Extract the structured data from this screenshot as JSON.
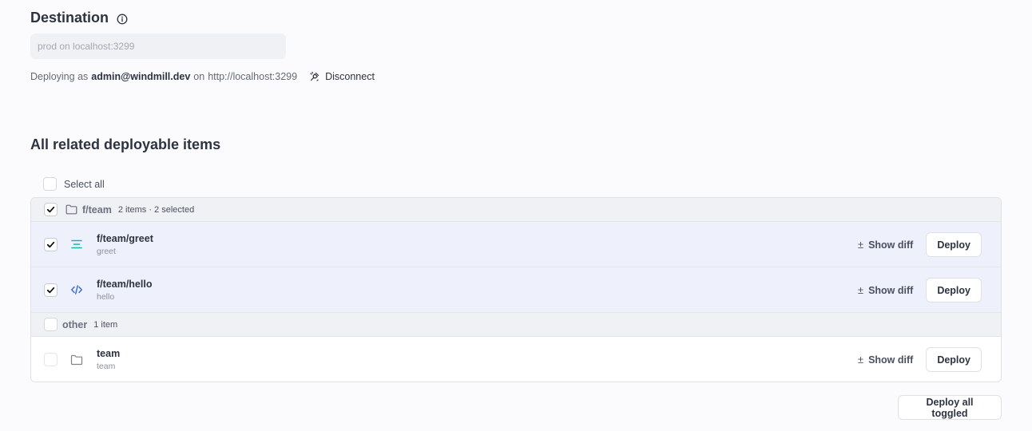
{
  "destination": {
    "title": "Destination",
    "placeholder": "prod on localhost:3299",
    "deploying_prefix": "Deploying as",
    "user": "admin@windmill.dev",
    "on_label": "on",
    "url": "http://localhost:3299",
    "disconnect_label": "Disconnect"
  },
  "items_section": {
    "title": "All related deployable items",
    "select_all_label": "Select all"
  },
  "groups": [
    {
      "name": "f/team",
      "meta": "2 items · 2 selected",
      "checked": true,
      "items": [
        {
          "path": "f/team/greet",
          "summary": "greet",
          "icon": "flow-icon",
          "checked": true
        },
        {
          "path": "f/team/hello",
          "summary": "hello",
          "icon": "code-icon",
          "checked": true
        }
      ]
    },
    {
      "name": "other",
      "meta": "1 item",
      "checked": false,
      "items": [
        {
          "path": "team",
          "summary": "team",
          "icon": "folder-icon",
          "checked": false
        }
      ]
    }
  ],
  "actions": {
    "show_diff_symbol": "±",
    "show_diff_label": "Show diff",
    "deploy_label": "Deploy",
    "deploy_all_label": "Deploy all toggled"
  },
  "colors": {
    "accent": "#14b8a6",
    "code_icon": "#3b6fd4",
    "selected_row": "#eef0fc"
  }
}
